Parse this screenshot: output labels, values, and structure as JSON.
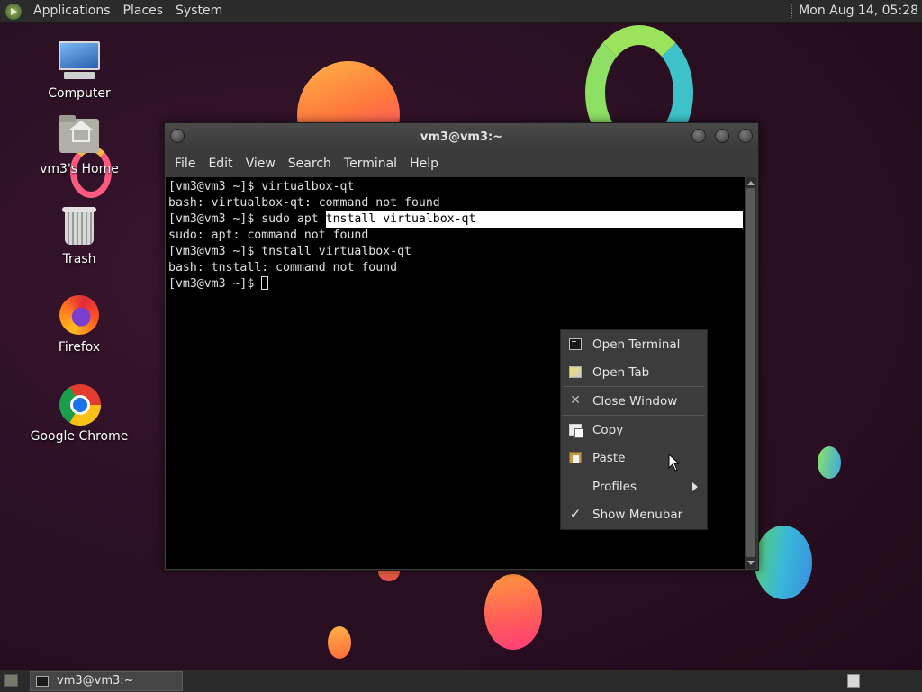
{
  "top_panel": {
    "menus": [
      "Applications",
      "Places",
      "System"
    ],
    "clock": "Mon Aug 14, 05:28"
  },
  "desktop_icons": [
    {
      "label": "Computer",
      "icon": "computer-icon"
    },
    {
      "label": "vm3's Home",
      "icon": "home-folder-icon"
    },
    {
      "label": "Trash",
      "icon": "trash-icon"
    },
    {
      "label": "Firefox",
      "icon": "firefox-icon"
    },
    {
      "label": "Google Chrome",
      "icon": "chrome-icon"
    }
  ],
  "terminal": {
    "title": "vm3@vm3:~",
    "menu": [
      "File",
      "Edit",
      "View",
      "Search",
      "Terminal",
      "Help"
    ],
    "lines": [
      "[vm3@vm3 ~]$ virtualbox-qt",
      "bash: virtualbox-qt: command not found",
      "[vm3@vm3 ~]$ sudo apt ",
      "sudo: apt: command not found",
      "[vm3@vm3 ~]$ tnstall virtualbox-qt",
      "bash: tnstall: command not found",
      "[vm3@vm3 ~]$ "
    ],
    "selected_text": "tnstall virtualbox-qt"
  },
  "context_menu": {
    "items": [
      {
        "label": "Open Terminal",
        "icon": "terminal-icon"
      },
      {
        "label": "Open Tab",
        "icon": "new-tab-icon"
      },
      {
        "label": "Close Window",
        "icon": "close-icon"
      },
      {
        "label": "Copy",
        "icon": "copy-icon"
      },
      {
        "label": "Paste",
        "icon": "paste-icon"
      },
      {
        "label": "Profiles",
        "icon": "submenu-arrow-icon"
      },
      {
        "label": "Show Menubar",
        "icon": "checkmark-icon",
        "checked": true
      }
    ]
  },
  "taskbar": {
    "task_label": "vm3@vm3:~"
  }
}
